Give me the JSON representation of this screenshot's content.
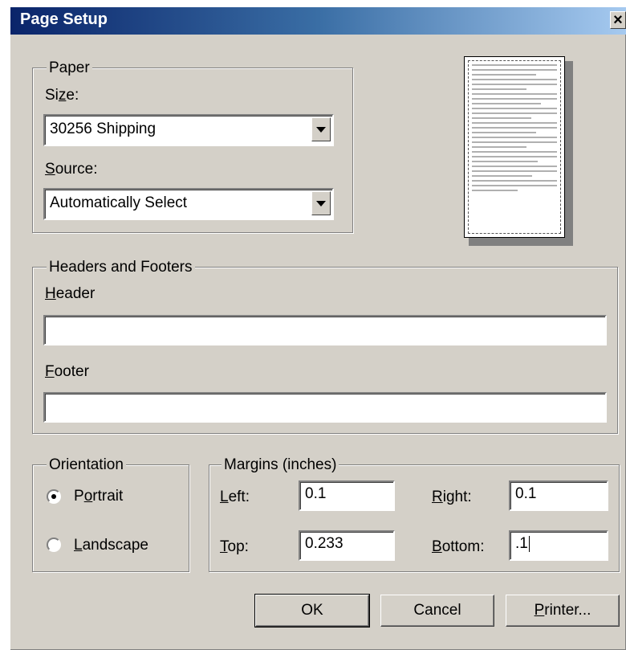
{
  "window": {
    "title": "Page Setup",
    "close_glyph": "×"
  },
  "paper": {
    "group_label": "Paper",
    "size_label": "Size:",
    "size_value": "30256 Shipping",
    "source_label": "Source:",
    "source_value": "Automatically Select"
  },
  "headers_footers": {
    "group_label": "Headers and Footers",
    "header_label": "Header",
    "header_value": "",
    "footer_label": "Footer",
    "footer_value": ""
  },
  "orientation": {
    "group_label": "Orientation",
    "portrait_label": "Portrait",
    "landscape_label": "Landscape",
    "selected": "portrait"
  },
  "margins": {
    "group_label": "Margins (inches)",
    "left_label": "Left:",
    "left_value": "0.1",
    "right_label": "Right:",
    "right_value": "0.1",
    "top_label": "Top:",
    "top_value": "0.233",
    "bottom_label": "Bottom:",
    "bottom_value": ".1"
  },
  "buttons": {
    "ok": "OK",
    "cancel": "Cancel",
    "printer": "Printer..."
  }
}
